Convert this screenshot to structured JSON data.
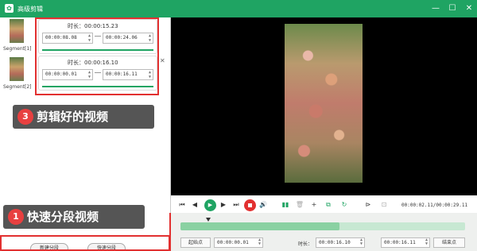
{
  "window": {
    "title": "高级剪辑",
    "minimize": "—",
    "maximize": "☐",
    "close": "✕"
  },
  "segments": [
    {
      "label": "Segment[1]",
      "duration": "时长：00:00:15.23",
      "start": "00:00:08.08",
      "end": "00:00:24.06"
    },
    {
      "label": "Segment[2]",
      "duration": "时长：00:00:16.10",
      "start": "00:00:00.01",
      "end": "00:00:16.11"
    }
  ],
  "callouts": {
    "edited": {
      "num": "3",
      "text": "剪辑好的视频"
    },
    "split": {
      "num": "1",
      "text": "快速分段视频"
    }
  },
  "buttons": {
    "new_segment": "新建分段",
    "quick_split": "快速分段"
  },
  "player": {
    "timecode": "00:00:02.11/00:00:29.11"
  },
  "range": {
    "start_label": "起始点",
    "start": "00:00:00.01",
    "duration_label": "时长：",
    "duration": "00:00:16.10",
    "end": "00:00:16.11",
    "end_label": "结束点"
  },
  "colors": {
    "accent": "#1fa463",
    "highlight": "#e23030"
  }
}
